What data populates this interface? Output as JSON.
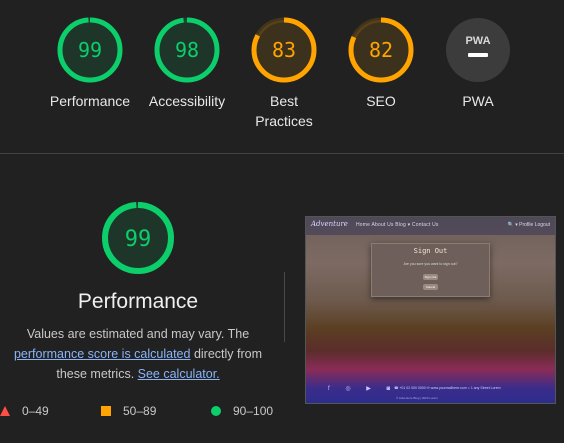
{
  "colors": {
    "pass": "#0cce6b",
    "average": "#ffa400",
    "fail": "#ff4e42",
    "na": "#9e9e9e"
  },
  "gauges": [
    {
      "score": "99",
      "value": 99,
      "label": "Performance",
      "status": "pass"
    },
    {
      "score": "98",
      "value": 98,
      "label": "Accessibility",
      "status": "pass"
    },
    {
      "score": "83",
      "value": 83,
      "label": "Best Practices",
      "status": "average"
    },
    {
      "score": "82",
      "value": 82,
      "label": "SEO",
      "status": "average"
    },
    {
      "score": "",
      "value": null,
      "label": "PWA",
      "status": "na",
      "icon_text": "PWA"
    }
  ],
  "main": {
    "score": "99",
    "value": 99,
    "title": "Performance",
    "explainer_text_1": "Values are estimated and may vary. The ",
    "explainer_link_1": "performance score is calculated",
    "explainer_text_2": " directly from these metrics. ",
    "explainer_link_2": "See calculator."
  },
  "legend": [
    {
      "shape": "triangle",
      "range": "0–49",
      "status": "fail"
    },
    {
      "shape": "square",
      "range": "50–89",
      "status": "average"
    },
    {
      "shape": "circle",
      "range": "90–100",
      "status": "pass"
    }
  ],
  "screenshot": {
    "logo": "Adventure",
    "nav": "Home  About Us  Blog ▾  Contact Us",
    "nav_right": "🔍 ▾  Profile  Logout",
    "modal_title": "Sign Out",
    "modal_text": "Are you sure you want to sign out?",
    "modal_button_1": "Sign Out",
    "modal_button_2": "Cancel",
    "social": "f ◎ ▶ ◙",
    "contact": "☎ +01 02 000 0000   ✉ www.yourmailhere.com   ⌂ 1 any Street Lorem",
    "copyright": "© Adventure Blog | 2023 Lorem"
  }
}
